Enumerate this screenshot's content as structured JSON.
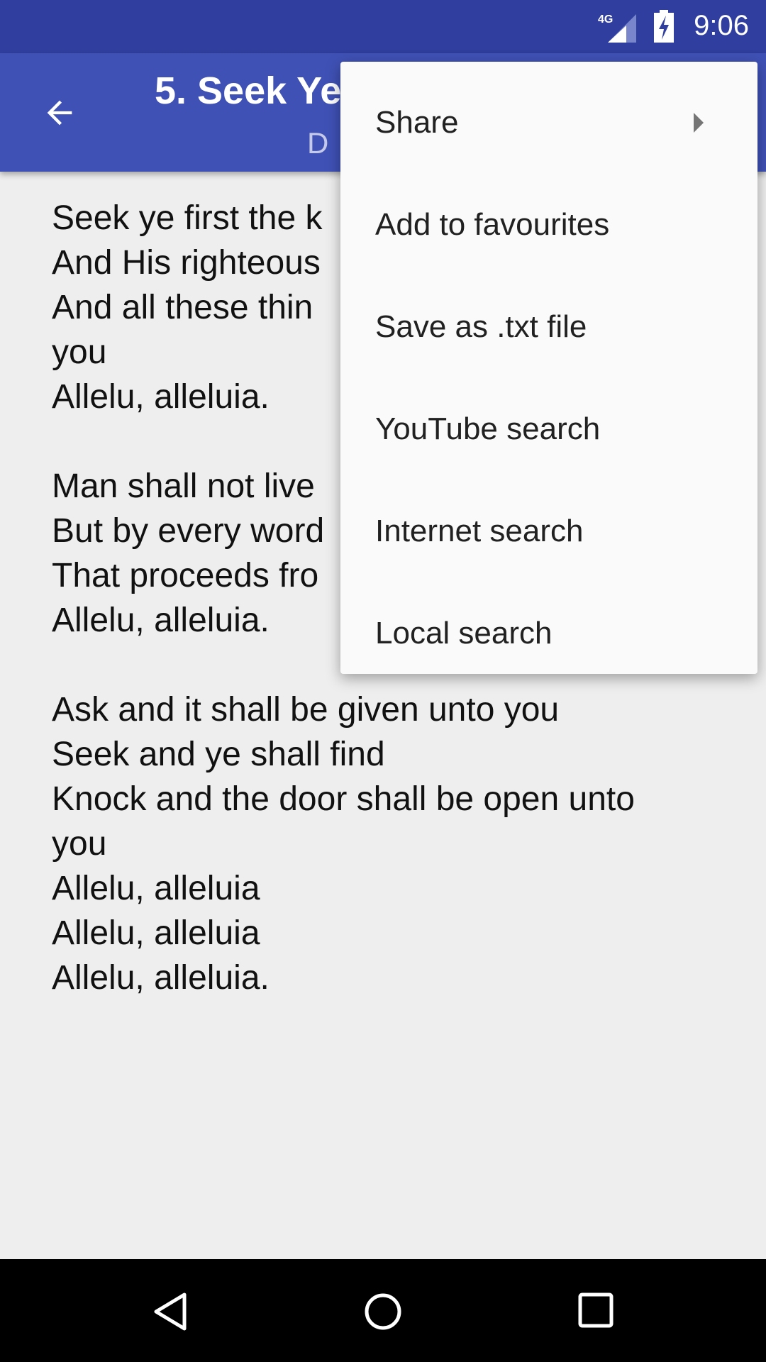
{
  "status_bar": {
    "network": "4G",
    "time": "9:06",
    "icons": [
      "signal-icon",
      "battery-charging-icon"
    ]
  },
  "app_bar": {
    "title": "5. Seek Ye",
    "subtitle": "D",
    "back_icon": "arrow-left-icon"
  },
  "lyrics": [
    "Seek ye first the k",
    "And His righteous",
    "And all these thin",
    "you",
    "Allelu, alleluia.",
    "",
    "Man shall not live",
    "But by every word",
    "That proceeds fro",
    "Allelu, alleluia.",
    "",
    "Ask and it shall be given unto you",
    "Seek and ye shall find",
    "Knock and the door shall be open unto",
    "you",
    "Allelu, alleluia",
    "Allelu, alleluia",
    "Allelu, alleluia."
  ],
  "menu": {
    "items": [
      {
        "label": "Share",
        "submenu": true
      },
      {
        "label": "Add to favourites"
      },
      {
        "label": "Save as .txt file"
      },
      {
        "label": "YouTube search"
      },
      {
        "label": "Internet search"
      },
      {
        "label": "Local search"
      }
    ]
  },
  "nav_bar": {
    "icons": [
      "back-triangle-icon",
      "home-circle-icon",
      "recents-square-icon"
    ]
  },
  "colors": {
    "status_bar": "#303f9f",
    "app_bar": "#3f51b5",
    "background": "#eeeeee"
  }
}
